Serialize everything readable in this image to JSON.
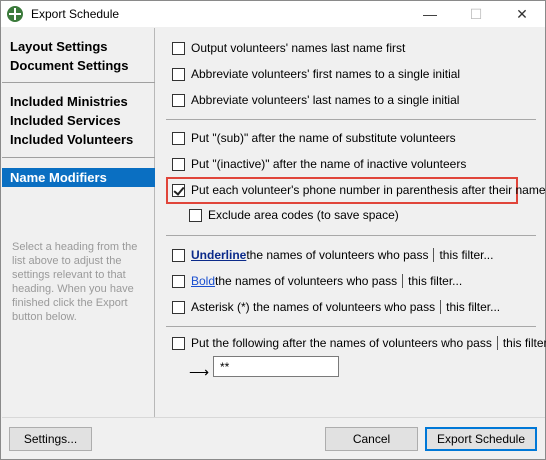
{
  "window": {
    "title": "Export Schedule",
    "controls": {
      "minimize": "—",
      "maximize": "☐",
      "close": "✕"
    }
  },
  "sidebar": {
    "group1": [
      "Layout Settings",
      "Document Settings"
    ],
    "group2": [
      "Included Ministries",
      "Included Services",
      "Included Volunteers"
    ],
    "selected": "Name Modifiers",
    "help": "Select a heading from the list above to adjust the settings relevant to that heading. When you have finished click the Export button below."
  },
  "options": {
    "last_name_first": "Output volunteers' names last name first",
    "abbrev_first": "Abbreviate volunteers' first names to a single initial",
    "abbrev_last": "Abbreviate volunteers' last names to a single initial",
    "sub": "Put \"(sub)\" after the name of substitute volunteers",
    "inactive": "Put \"(inactive)\" after the name of inactive volunteers",
    "phone": "Put each volunteer's phone number in parenthesis after their name",
    "exclude_area": "Exclude area codes (to save space)",
    "underline_word": "Underline",
    "underline_rest": " the names of volunteers who pass",
    "bold_word": "Bold",
    "bold_rest": " the names of volunteers who pass",
    "asterisk": "Asterisk (*) the names of volunteers who pass",
    "put_following": "Put the following after the names of volunteers who pass",
    "filter_link": "this filter...",
    "suffix_value": "**"
  },
  "buttons": {
    "settings": "Settings...",
    "cancel": "Cancel",
    "export": "Export Schedule"
  }
}
